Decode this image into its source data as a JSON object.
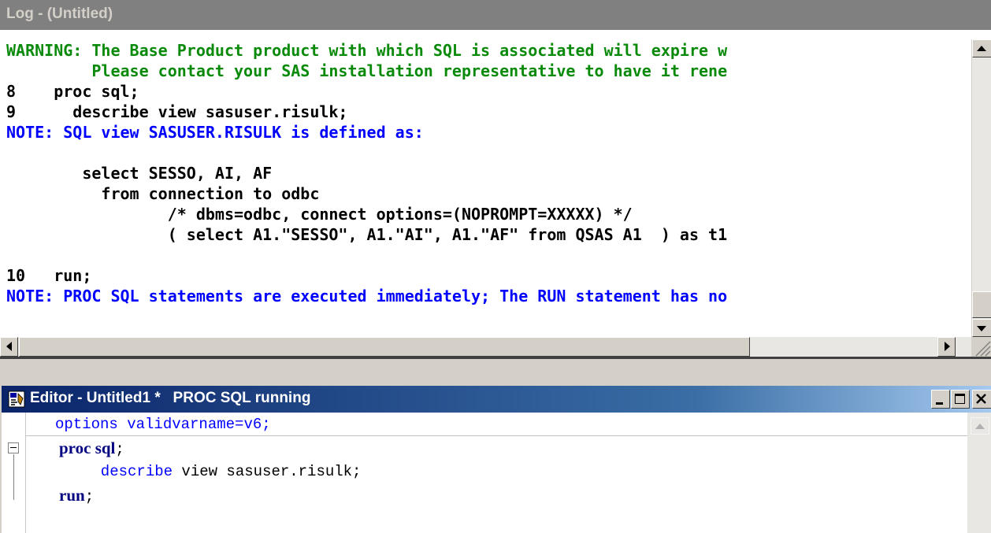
{
  "log": {
    "title": "Log - (Untitled)",
    "lines": [
      {
        "num": "",
        "text": "WARNING: The Base Product product with which SQL is associated will expire w",
        "color": "#0a8a0a"
      },
      {
        "num": "",
        "text": "         Please contact your SAS installation representative to have it rene",
        "color": "#0a8a0a"
      },
      {
        "num": "8",
        "text": "     proc sql;",
        "color": "#000000"
      },
      {
        "num": "9",
        "text": "       describe view sasuser.risulk;",
        "color": "#000000"
      },
      {
        "num": "",
        "text": "NOTE: SQL view SASUSER.RISULK is defined as:",
        "color": "#0000ff"
      },
      {
        "num": "",
        "text": "",
        "color": "#000000"
      },
      {
        "num": "",
        "text": "        select SESSO, AI, AF",
        "color": "#000000"
      },
      {
        "num": "",
        "text": "          from connection to odbc",
        "color": "#000000"
      },
      {
        "num": "",
        "text": "                 /* dbms=odbc, connect options=(NOPROMPT=XXXXX) */",
        "color": "#000000"
      },
      {
        "num": "",
        "text": "                 ( select A1.\"SESSO\", A1.\"AI\", A1.\"AF\" from QSAS A1  ) as t1",
        "color": "#000000"
      },
      {
        "num": "",
        "text": "",
        "color": "#000000"
      },
      {
        "num": "10",
        "text": "     run;",
        "color": "#000000"
      },
      {
        "num": "",
        "text": "NOTE: PROC SQL statements are executed immediately; The RUN statement has no",
        "color": "#0000ff"
      }
    ]
  },
  "editor": {
    "title": "Editor - Untitled1 *   PROC SQL running",
    "lines": [
      {
        "parts": [
          {
            "t": "options validvarname=v6;",
            "cls": "ed-blue"
          }
        ]
      },
      {
        "parts": [
          {
            "t": "proc sql",
            "cls": "ed-kw"
          },
          {
            "t": ";",
            "cls": "ed-plain"
          }
        ]
      },
      {
        "parts": [
          {
            "t": "  describe ",
            "cls": "ed-blue"
          },
          {
            "t": "view sasuser.risulk;",
            "cls": "ed-plain"
          }
        ]
      },
      {
        "parts": [
          {
            "t": "run",
            "cls": "ed-kw"
          },
          {
            "t": ";",
            "cls": "ed-plain"
          }
        ]
      }
    ]
  },
  "icons": {
    "log_scroll_up": "arrow-up-icon",
    "log_scroll_down": "arrow-down-icon",
    "log_scroll_left": "arrow-left-icon",
    "log_scroll_right": "arrow-right-icon",
    "editor_app": "sas-editor-icon",
    "minimize": "minimize-icon",
    "restore": "restore-icon",
    "close": "close-icon",
    "collapse": "collapse-icon"
  },
  "colors": {
    "warning": "#0a8a0a",
    "note": "#0000ff",
    "keyword": "#000080",
    "titlebar_active_start": "#0a246a",
    "titlebar_inactive": "#808080"
  }
}
